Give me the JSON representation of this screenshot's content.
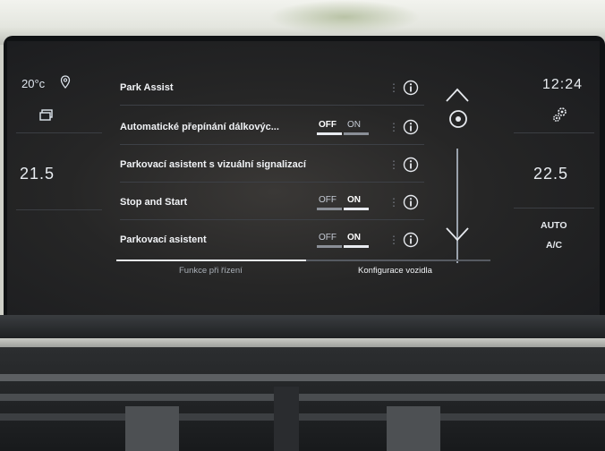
{
  "left_panel": {
    "outside_temp": "20°c",
    "driver_temp": "21.5"
  },
  "right_panel": {
    "time": "12:24",
    "passenger_temp": "22.5",
    "auto_label": "AUTO",
    "ac_label": "A/C"
  },
  "menu": {
    "rows": [
      {
        "label": "Park Assist"
      },
      {
        "label": "Automatické přepínání dálkovýc...",
        "toggle": {
          "off": "OFF",
          "on": "ON",
          "state": "off"
        }
      },
      {
        "label": "Parkovací asistent s vizuální signalizací"
      },
      {
        "label": "Stop and Start",
        "toggle": {
          "off": "OFF",
          "on": "ON",
          "state": "on"
        }
      },
      {
        "label": "Parkovací asistent",
        "toggle": {
          "off": "OFF",
          "on": "ON",
          "state": "on"
        }
      }
    ]
  },
  "tabs": [
    {
      "label": "Funkce při řízení",
      "active": true
    },
    {
      "label": "Konfigurace vozidla",
      "active": false
    }
  ],
  "icons": {
    "location": "location-pin-icon",
    "windows": "windows-icon",
    "settings": "gears-icon",
    "info": "info-icon",
    "scroll_up": "chevron-up-icon",
    "scroll_down": "chevron-down-icon"
  },
  "colors": {
    "screen_bg": "#222326",
    "text": "#e6e9ee",
    "toggle_on": "#e8ebf0",
    "toggle_off": "#8a8f97"
  }
}
